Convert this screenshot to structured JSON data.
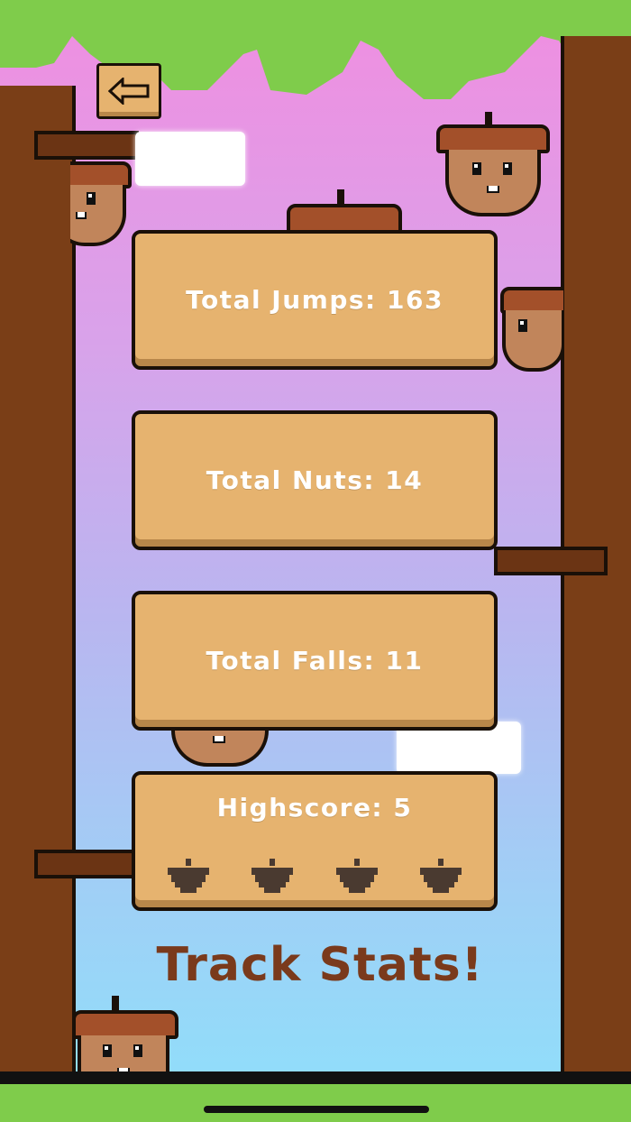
{
  "navigation": {
    "back_icon": "left-arrow-icon"
  },
  "stats": {
    "jumps_label": "Total Jumps: 163",
    "nuts_label": "Total Nuts: 14",
    "falls_label": "Total Falls: 11",
    "highscore_label": "Highscore: 5"
  },
  "highscore_acorns": {
    "count": 4,
    "icon": "acorn-icon"
  },
  "tagline": "Track Stats!",
  "colors": {
    "card": "#e6b36f",
    "card_shadow": "#b8874a",
    "trunk": "#7a3e17",
    "leaves": "#7fcc4b",
    "acorn_cap": "#a3502a",
    "acorn_body": "#c1855b",
    "tagline": "#7a3a1c"
  }
}
